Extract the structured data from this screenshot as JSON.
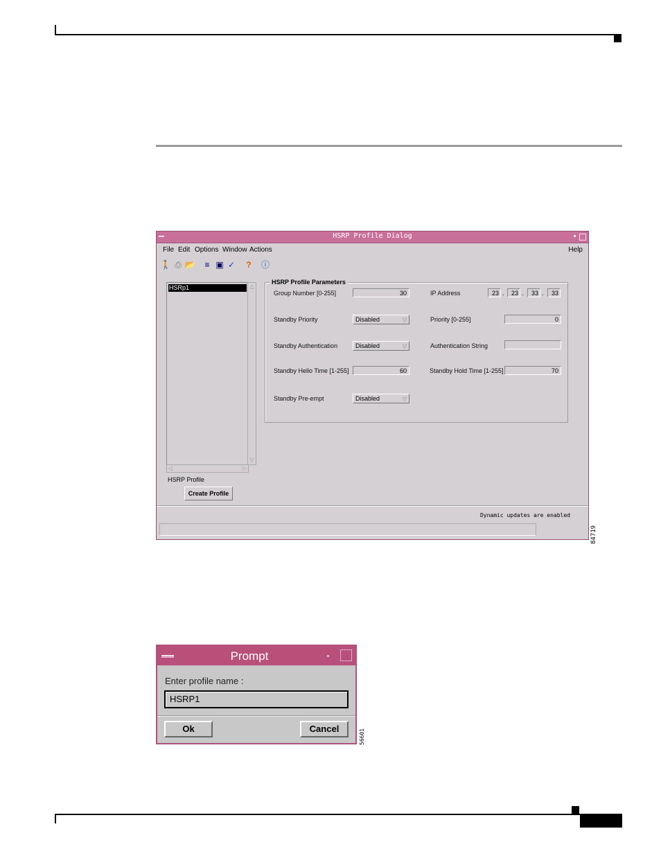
{
  "hsrp_dialog": {
    "title": "HSRP Profile Dialog",
    "menu": [
      {
        "label": "File"
      },
      {
        "label": "Edit"
      },
      {
        "label": "Options"
      },
      {
        "label": "Window"
      },
      {
        "label": "Actions"
      }
    ],
    "help_menu": "Help",
    "toolbar_icons": [
      "exit-icon",
      "print-icon",
      "open-folder-icon",
      "list-icon",
      "monitor-icon",
      "checkmark-icon",
      "help-icon",
      "info-icon"
    ],
    "profile_list": {
      "items": [
        "HSRp1"
      ],
      "selected": "HSRp1",
      "caption": "HSRP Profile"
    },
    "create_button": "Create Profile",
    "params": {
      "group_title": "HSRP Profile Parameters",
      "group_number": {
        "label": "Group Number [0-255]",
        "value": "30"
      },
      "ip_address": {
        "label": "IP Address",
        "octets": [
          "23",
          "23",
          "33",
          "33"
        ]
      },
      "standby_priority": {
        "label": "Standby Priority",
        "value": "Disabled"
      },
      "priority": {
        "label": "Priority [0-255]",
        "value": "0"
      },
      "standby_auth": {
        "label": "Standby Authentication",
        "value": "Disabled"
      },
      "auth_string": {
        "label": "Authentication String",
        "value": ""
      },
      "hello_time": {
        "label": "Standby Hello Time [1-255]",
        "value": "60"
      },
      "hold_time": {
        "label": "Standby Hold Time [1-255]",
        "value": "70"
      },
      "preempt": {
        "label": "Standby Pre-empt",
        "value": "Disabled"
      }
    },
    "status": "Dynamic updates are enabled",
    "figure_id": "84719"
  },
  "prompt_dialog": {
    "title": "Prompt",
    "label": "Enter profile name :",
    "input_value": "HSRP1",
    "ok": "Ok",
    "cancel": "Cancel",
    "figure_id": "56601"
  }
}
